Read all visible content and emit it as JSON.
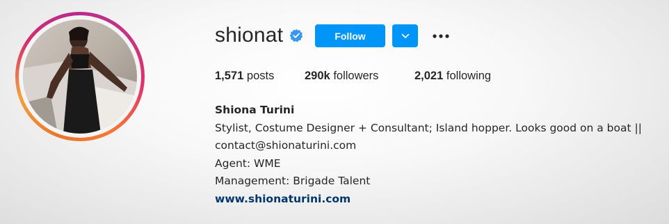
{
  "profile": {
    "username": "shionat",
    "verified": true,
    "follow_label": "Follow",
    "posts_count": "1,571",
    "posts_label": "posts",
    "followers_count": "290k",
    "followers_label": "followers",
    "following_count": "2,021",
    "following_label": "following",
    "full_name": "Shiona Turini",
    "bio_lines": [
      "Stylist, Costume Designer + Consultant; Island hopper. Looks good on a boat ||",
      "contact@shionaturini.com",
      "Agent: WME",
      "Management: Brigade Talent"
    ],
    "website": "www.shionaturini.com"
  },
  "icons": {
    "verified": "verified-badge-icon",
    "dropdown": "chevron-down-icon",
    "more": "more-options-icon"
  },
  "colors": {
    "accent": "#0095f6",
    "verified": "#3897f0",
    "link": "#00376b",
    "text": "#262626"
  }
}
